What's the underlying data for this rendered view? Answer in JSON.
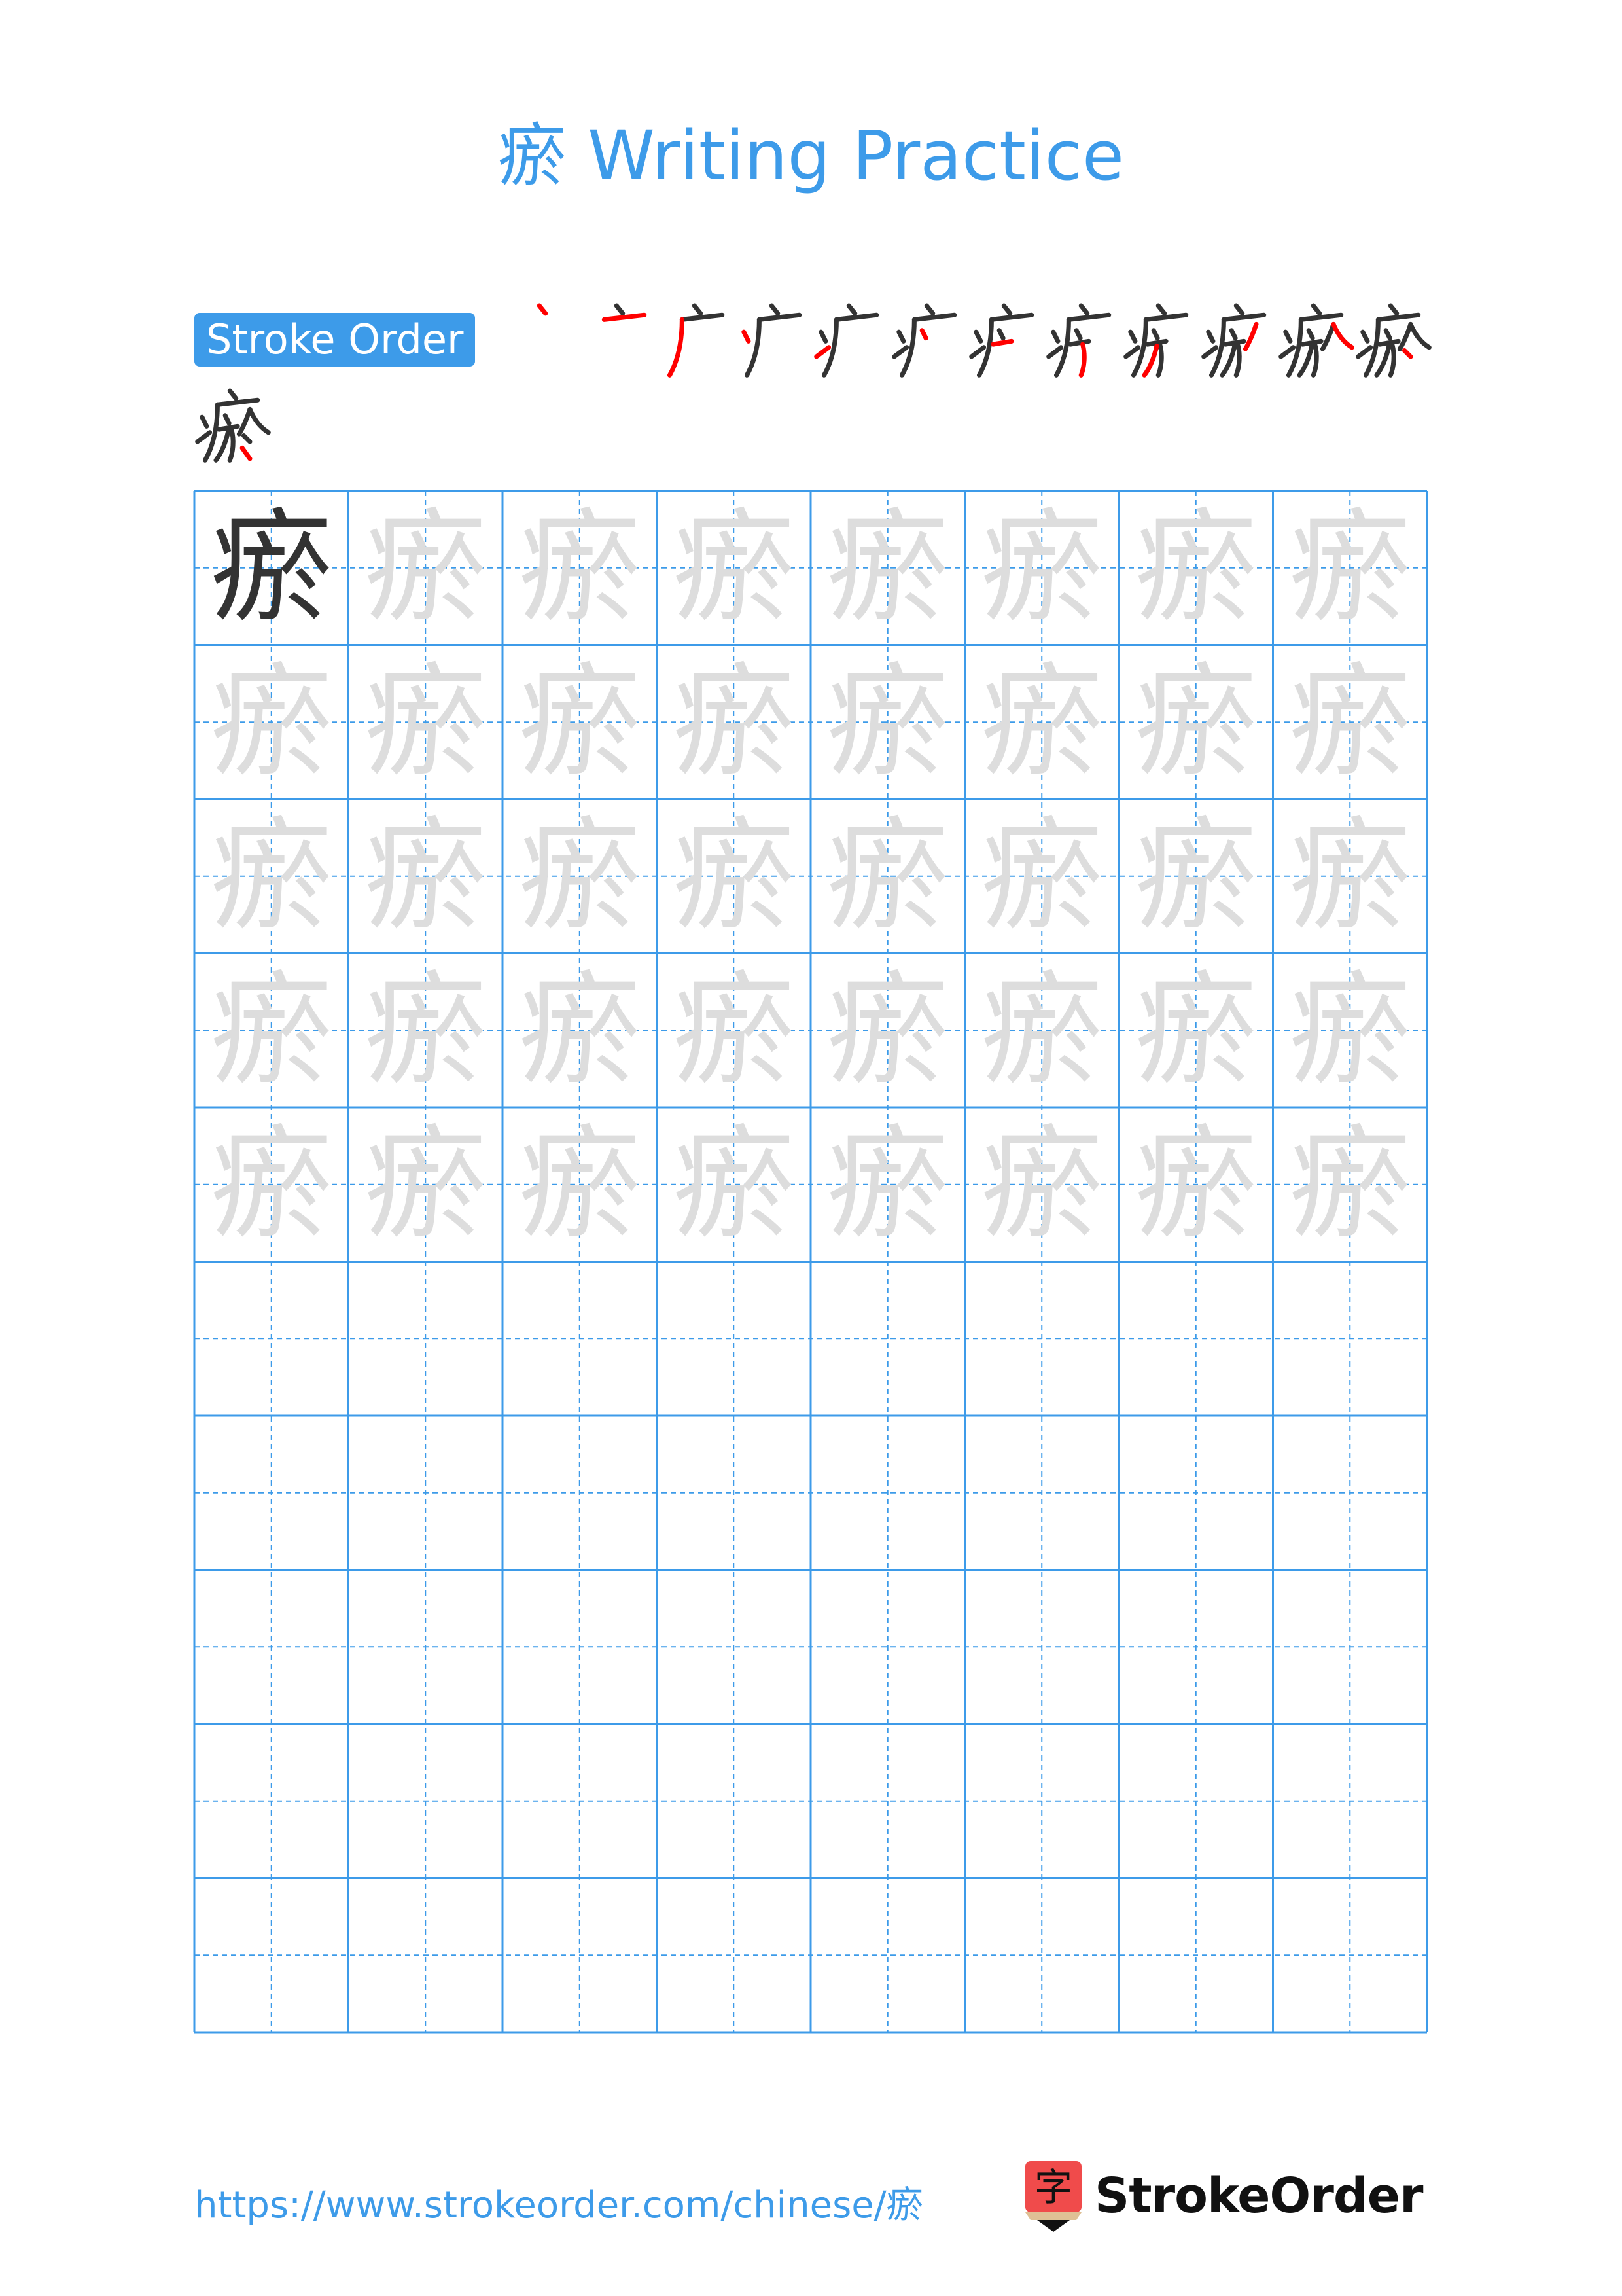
{
  "page": {
    "character": "瘀",
    "title": "瘀 Writing Practice",
    "accent_color": "#3d9be9",
    "highlight_stroke_color": "#ff0000",
    "ink_color": "#333333",
    "trace_color": "#dddddd"
  },
  "stroke_order": {
    "label": "Stroke Order",
    "stroke_count": 13,
    "frames": [
      {
        "step": 1,
        "partial": "丶"
      },
      {
        "step": 2,
        "partial": "亠"
      },
      {
        "step": 3,
        "partial": "广"
      },
      {
        "step": 4,
        "partial": "疒(4)"
      },
      {
        "step": 5,
        "partial": "疒(5)"
      },
      {
        "step": 6,
        "partial": "疒(6)"
      },
      {
        "step": 7,
        "partial": "疒 + 一"
      },
      {
        "step": 8,
        "partial": "疒 + 方(3)"
      },
      {
        "step": 9,
        "partial": "疒 + 方"
      },
      {
        "step": 10,
        "partial": "疒 + 方 + 丿"
      },
      {
        "step": 11,
        "partial": "疒 + 方 + 人"
      },
      {
        "step": 12,
        "partial": "疒 + 方 + 人 + 丶"
      },
      {
        "step": 13,
        "partial": "瘀"
      }
    ]
  },
  "practice_grid": {
    "columns": 8,
    "rows": 10,
    "model_cells": 1,
    "trace_rows": 5,
    "empty_rows": 5,
    "grid_style": "solid borders with dashed center cross"
  },
  "footer": {
    "url": "https://www.strokeorder.com/chinese/瘀",
    "logo_glyph": "字",
    "logo_text": "StrokeOrder",
    "logo_color": "#f04b4b",
    "logo_tip_color": "#dfc095"
  }
}
